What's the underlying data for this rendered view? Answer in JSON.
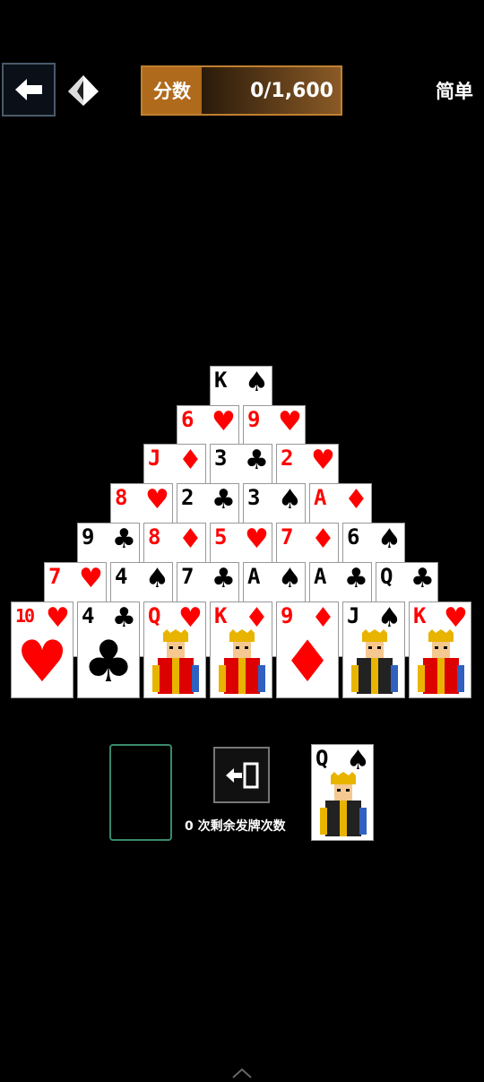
{
  "header": {
    "score_label": "分数",
    "score_value": "0/1,600",
    "difficulty": "简单"
  },
  "pyramid": [
    [
      "K♠"
    ],
    [
      "6♥",
      "9♥"
    ],
    [
      "J♦",
      "3♣",
      "2♥"
    ],
    [
      "8♥",
      "2♣",
      "3♠",
      "A♦"
    ],
    [
      "9♣",
      "8♦",
      "5♥",
      "7♦",
      "6♠"
    ],
    [
      "7♥",
      "4♠",
      "7♣",
      "A♠",
      "A♣",
      "Q♣"
    ],
    [
      "10♥",
      "4♣",
      "Q♥",
      "K♦",
      "9♦",
      "J♠",
      "K♥"
    ]
  ],
  "waste": "Q♠",
  "stock": {
    "cards_left": 0
  },
  "redeal": {
    "text": "0 次剩余发牌次数"
  },
  "colors": {
    "red": "#ff0000",
    "black": "#000000",
    "accent": "#b06a1c",
    "stock_border": "#3a8a6a"
  }
}
